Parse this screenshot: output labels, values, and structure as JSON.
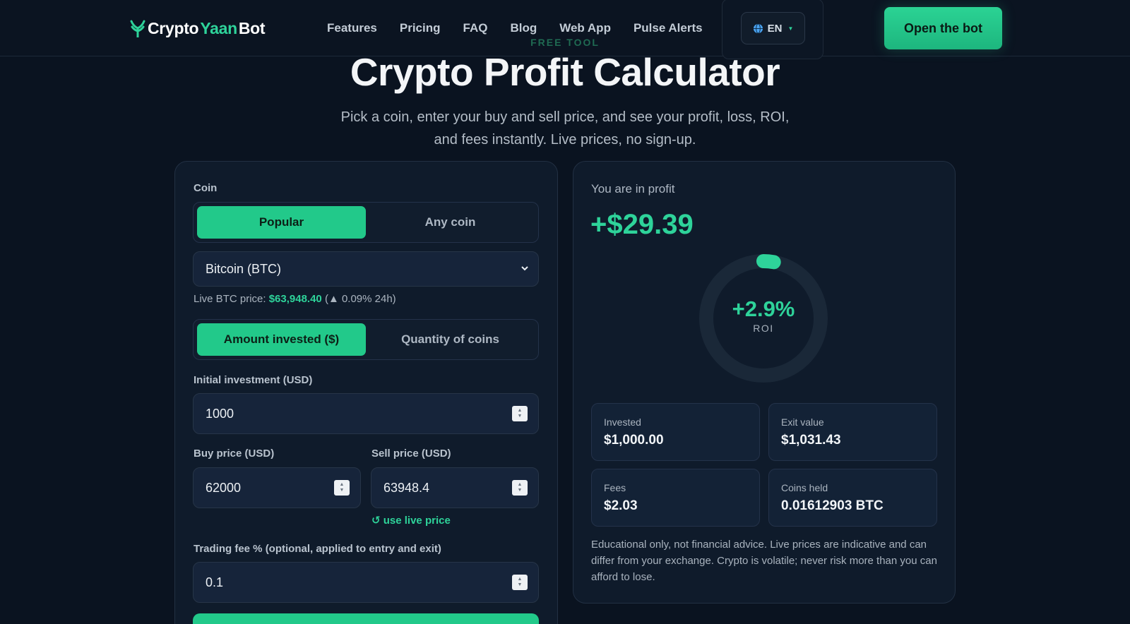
{
  "brand": {
    "name_part1": "Crypto",
    "name_part2": "Yaan",
    "name_part3": "Bot"
  },
  "nav": {
    "items": [
      "Features",
      "Pricing",
      "FAQ",
      "Blog",
      "Web App",
      "Pulse Alerts"
    ],
    "language": "EN",
    "cta": "Open the bot"
  },
  "hero": {
    "eyebrow": "FREE TOOL",
    "title": "Crypto Profit Calculator",
    "subtitle_line1": "Pick a coin, enter your buy and sell price, and see your profit, loss, ROI,",
    "subtitle_line2": "and fees instantly. Live prices, no sign-up."
  },
  "form": {
    "coin_label": "Coin",
    "coin_tabs": [
      "Popular",
      "Any coin"
    ],
    "coin_selected": "Bitcoin (BTC)",
    "live_price_prefix": "Live BTC price: ",
    "live_price_value": "$63,948.40",
    "live_price_change": " (▲ 0.09% 24h)",
    "mode_tabs": [
      "Amount invested ($)",
      "Quantity of coins"
    ],
    "initial_label": "Initial investment (USD)",
    "initial_value": "1000",
    "buy_label": "Buy price (USD)",
    "buy_value": "62000",
    "sell_label": "Sell price (USD)",
    "sell_value": "63948.4",
    "use_live": "↺ use live price",
    "fee_label": "Trading fee % (optional, applied to entry and exit)",
    "fee_value": "0.1"
  },
  "result": {
    "status": "You are in profit",
    "profit": "+$29.39",
    "roi_value": "+2.9%",
    "roi_label": "ROI",
    "roi_fraction": 0.029,
    "stats": [
      {
        "label": "Invested",
        "value": "$1,000.00"
      },
      {
        "label": "Exit value",
        "value": "$1,031.43"
      },
      {
        "label": "Fees",
        "value": "$2.03"
      },
      {
        "label": "Coins held",
        "value": "0.01612903 BTC"
      }
    ],
    "disclaimer": "Educational only, not financial advice. Live prices are indicative and can differ from your exchange. Crypto is volatile; never risk more than you can afford to lose."
  },
  "colors": {
    "accent": "#22c98a",
    "background": "#0a1320",
    "panel": "#0f1b2b"
  }
}
